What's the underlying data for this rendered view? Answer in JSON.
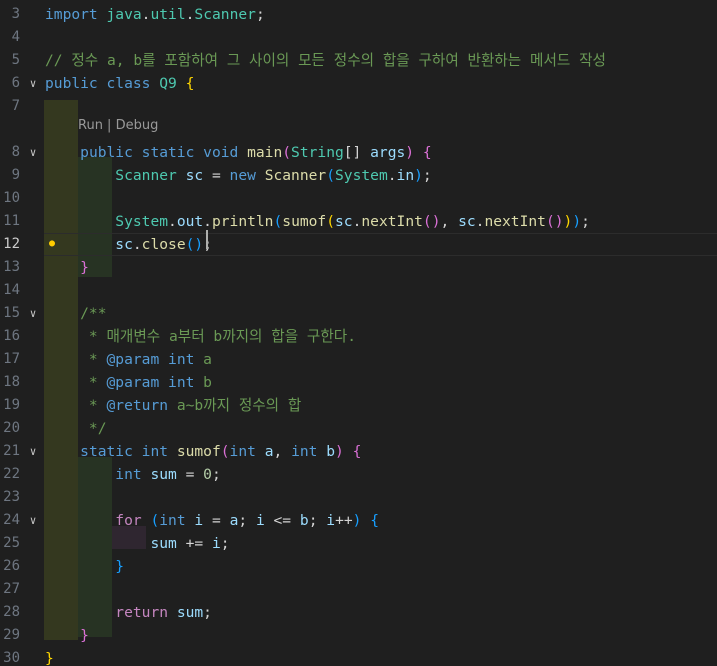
{
  "editor": {
    "codelens": "Run | Debug",
    "active_line": "12",
    "lines": [
      {
        "n": "3",
        "fold": false,
        "tokens": [
          [
            "import ",
            "kw"
          ],
          [
            "java",
            "ty"
          ],
          [
            ".",
            "pn"
          ],
          [
            "util",
            "ty"
          ],
          [
            ".",
            "pn"
          ],
          [
            "Scanner",
            "ty"
          ],
          [
            ";",
            "pn"
          ]
        ]
      },
      {
        "n": "4",
        "fold": false,
        "tokens": []
      },
      {
        "n": "5",
        "fold": false,
        "tokens": [
          [
            "// 정수 a, b를 포함하여 그 사이의 모든 정수의 합을 구하여 반환하는 메서드 작성",
            "cm"
          ]
        ]
      },
      {
        "n": "6",
        "fold": true,
        "tokens": [
          [
            "public class ",
            "kw"
          ],
          [
            "Q9",
            "ty"
          ],
          [
            " ",
            "pn"
          ],
          [
            "{",
            "b1"
          ]
        ]
      },
      {
        "n": "7",
        "fold": false,
        "tokens": []
      },
      {
        "n": "8",
        "fold": true,
        "tokens": [
          [
            "    ",
            "pn"
          ],
          [
            "public static void ",
            "kw"
          ],
          [
            "main",
            "fn"
          ],
          [
            "(",
            "b2"
          ],
          [
            "String",
            "ty"
          ],
          [
            "[] ",
            "pn"
          ],
          [
            "args",
            "vr"
          ],
          [
            ")",
            "b2"
          ],
          [
            " ",
            "pn"
          ],
          [
            "{",
            "b2"
          ]
        ]
      },
      {
        "n": "9",
        "fold": false,
        "tokens": [
          [
            "        ",
            "pn"
          ],
          [
            "Scanner",
            "ty"
          ],
          [
            " ",
            "pn"
          ],
          [
            "sc",
            "vr"
          ],
          [
            " = ",
            "pn"
          ],
          [
            "new ",
            "kw"
          ],
          [
            "Scanner",
            "fn"
          ],
          [
            "(",
            "b3"
          ],
          [
            "System",
            "ty"
          ],
          [
            ".",
            "pn"
          ],
          [
            "in",
            "vr"
          ],
          [
            ")",
            "b3"
          ],
          [
            ";",
            "pn"
          ]
        ]
      },
      {
        "n": "10",
        "fold": false,
        "tokens": []
      },
      {
        "n": "11",
        "fold": false,
        "tokens": [
          [
            "        ",
            "pn"
          ],
          [
            "System",
            "ty"
          ],
          [
            ".",
            "pn"
          ],
          [
            "out",
            "vr"
          ],
          [
            ".",
            "pn"
          ],
          [
            "println",
            "fn"
          ],
          [
            "(",
            "b3"
          ],
          [
            "sumof",
            "fn"
          ],
          [
            "(",
            "b1"
          ],
          [
            "sc",
            "vr"
          ],
          [
            ".",
            "pn"
          ],
          [
            "nextInt",
            "fn"
          ],
          [
            "()",
            "b2"
          ],
          [
            ", ",
            "pn"
          ],
          [
            "sc",
            "vr"
          ],
          [
            ".",
            "pn"
          ],
          [
            "nextInt",
            "fn"
          ],
          [
            "()",
            "b2"
          ],
          [
            ")",
            "b1"
          ],
          [
            ")",
            "b3"
          ],
          [
            ";",
            "pn"
          ]
        ]
      },
      {
        "n": "12",
        "fold": false,
        "tokens": [
          [
            "        ",
            "pn"
          ],
          [
            "sc",
            "vr"
          ],
          [
            ".",
            "pn"
          ],
          [
            "close",
            "fn"
          ],
          [
            "()",
            "b3"
          ],
          [
            ";",
            "pn"
          ]
        ]
      },
      {
        "n": "13",
        "fold": false,
        "tokens": [
          [
            "    ",
            "pn"
          ],
          [
            "}",
            "b2"
          ]
        ]
      },
      {
        "n": "14",
        "fold": false,
        "tokens": []
      },
      {
        "n": "15",
        "fold": true,
        "tokens": [
          [
            "    /**",
            "cm"
          ]
        ]
      },
      {
        "n": "16",
        "fold": false,
        "tokens": [
          [
            "     * 매개변수 a부터 b까지의 합을 구한다.",
            "cm"
          ]
        ]
      },
      {
        "n": "17",
        "fold": false,
        "tokens": [
          [
            "     * ",
            "cm"
          ],
          [
            "@param",
            "cmtag"
          ],
          [
            " ",
            "cm"
          ],
          [
            "int",
            "kw"
          ],
          [
            " a",
            "cm"
          ]
        ]
      },
      {
        "n": "18",
        "fold": false,
        "tokens": [
          [
            "     * ",
            "cm"
          ],
          [
            "@param",
            "cmtag"
          ],
          [
            " ",
            "cm"
          ],
          [
            "int",
            "kw"
          ],
          [
            " b",
            "cm"
          ]
        ]
      },
      {
        "n": "19",
        "fold": false,
        "tokens": [
          [
            "     * ",
            "cm"
          ],
          [
            "@return",
            "cmtag"
          ],
          [
            " a~b까지 정수의 합",
            "cm"
          ]
        ]
      },
      {
        "n": "20",
        "fold": false,
        "tokens": [
          [
            "     */",
            "cm"
          ]
        ]
      },
      {
        "n": "21",
        "fold": true,
        "tokens": [
          [
            "    ",
            "pn"
          ],
          [
            "static int ",
            "kw"
          ],
          [
            "sumof",
            "fn"
          ],
          [
            "(",
            "b2"
          ],
          [
            "int ",
            "kw"
          ],
          [
            "a",
            "vr"
          ],
          [
            ", ",
            "pn"
          ],
          [
            "int ",
            "kw"
          ],
          [
            "b",
            "vr"
          ],
          [
            ")",
            "b2"
          ],
          [
            " ",
            "pn"
          ],
          [
            "{",
            "b2"
          ]
        ]
      },
      {
        "n": "22",
        "fold": false,
        "tokens": [
          [
            "        ",
            "pn"
          ],
          [
            "int ",
            "kw"
          ],
          [
            "sum",
            "vr"
          ],
          [
            " = ",
            "pn"
          ],
          [
            "0",
            "num"
          ],
          [
            ";",
            "pn"
          ]
        ]
      },
      {
        "n": "23",
        "fold": false,
        "tokens": []
      },
      {
        "n": "24",
        "fold": true,
        "tokens": [
          [
            "        ",
            "pn"
          ],
          [
            "for ",
            "ctl"
          ],
          [
            "(",
            "b3"
          ],
          [
            "int ",
            "kw"
          ],
          [
            "i",
            "vr"
          ],
          [
            " = ",
            "pn"
          ],
          [
            "a",
            "vr"
          ],
          [
            "; ",
            "pn"
          ],
          [
            "i",
            "vr"
          ],
          [
            " <= ",
            "pn"
          ],
          [
            "b",
            "vr"
          ],
          [
            "; ",
            "pn"
          ],
          [
            "i",
            "vr"
          ],
          [
            "++",
            "pn"
          ],
          [
            ")",
            "b3"
          ],
          [
            " ",
            "pn"
          ],
          [
            "{",
            "b3"
          ]
        ]
      },
      {
        "n": "25",
        "fold": false,
        "tokens": [
          [
            "            ",
            "pn"
          ],
          [
            "sum",
            "vr"
          ],
          [
            " += ",
            "pn"
          ],
          [
            "i",
            "vr"
          ],
          [
            ";",
            "pn"
          ]
        ]
      },
      {
        "n": "26",
        "fold": false,
        "tokens": [
          [
            "        ",
            "pn"
          ],
          [
            "}",
            "b3"
          ]
        ]
      },
      {
        "n": "27",
        "fold": false,
        "tokens": []
      },
      {
        "n": "28",
        "fold": false,
        "tokens": [
          [
            "        ",
            "pn"
          ],
          [
            "return ",
            "ctl"
          ],
          [
            "sum",
            "vr"
          ],
          [
            ";",
            "pn"
          ]
        ]
      },
      {
        "n": "29",
        "fold": false,
        "tokens": [
          [
            "    ",
            "pn"
          ],
          [
            "}",
            "b2"
          ]
        ]
      },
      {
        "n": "30",
        "fold": false,
        "tokens": [
          [
            "}",
            "b1"
          ]
        ]
      }
    ]
  }
}
